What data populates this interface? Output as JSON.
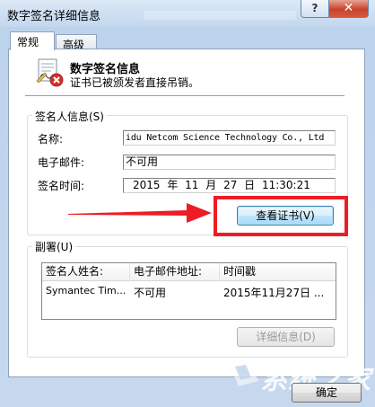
{
  "window": {
    "title": "数字签名详细信息",
    "help_label": "?",
    "close_label": "✕"
  },
  "tabs": [
    {
      "label": "常规",
      "active": true
    },
    {
      "label": "高级",
      "active": false
    }
  ],
  "header": {
    "icon": "certificate-revoked-icon",
    "title": "数字签名信息",
    "status": "证书已被颁发者直接吊销。"
  },
  "signer_info": {
    "legend": "签名人信息(S)",
    "name_label": "名称:",
    "name_value": "idu Netcom Science Technology Co., Ltd",
    "email_label": "电子邮件:",
    "email_value": "不可用",
    "time_label": "签名时间:",
    "time_value": "2015 年 11 月 27 日 11:30:21",
    "view_cert_label": "查看证书(V)"
  },
  "countersignatures": {
    "legend": "副署(U)",
    "columns": [
      "签名人姓名:",
      "电子邮件地址:",
      "时间戳"
    ],
    "rows": [
      [
        "Symantec Tim...",
        "不可用",
        "2015年11月27日 ..."
      ]
    ],
    "details_label": "详细信息(D)"
  },
  "ok_label": "确定",
  "watermark_text": "系统之家",
  "colors": {
    "highlight": "#ee1c24",
    "arrow": "#ee1c24"
  }
}
